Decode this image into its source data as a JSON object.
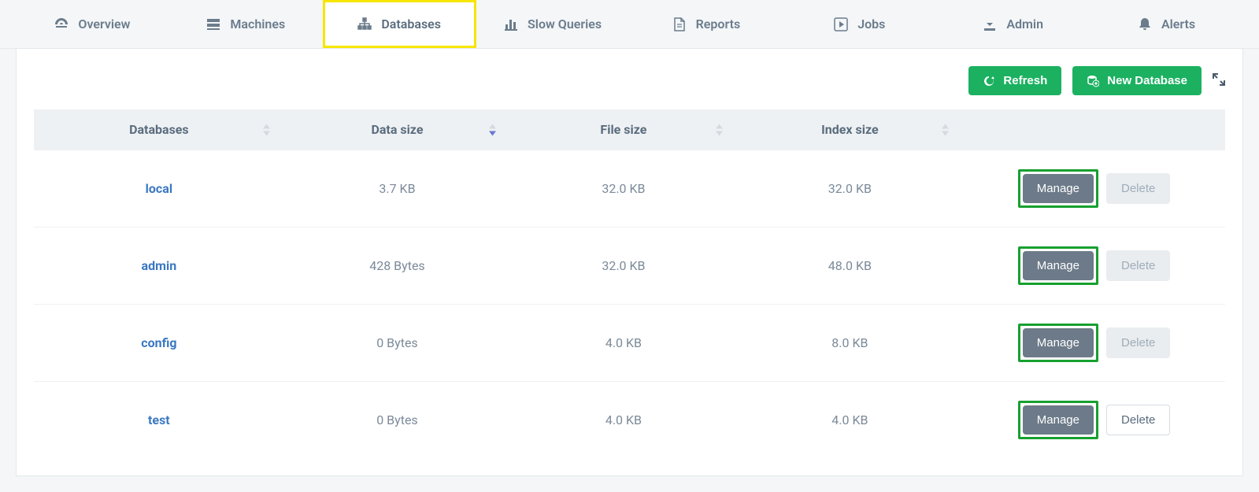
{
  "tabs": [
    {
      "label": "Overview",
      "icon": "dashboard"
    },
    {
      "label": "Machines",
      "icon": "server"
    },
    {
      "label": "Databases",
      "icon": "sitemap",
      "active": true
    },
    {
      "label": "Slow Queries",
      "icon": "bar-chart"
    },
    {
      "label": "Reports",
      "icon": "file"
    },
    {
      "label": "Jobs",
      "icon": "play"
    },
    {
      "label": "Admin",
      "icon": "download"
    },
    {
      "label": "Alerts",
      "icon": "bell"
    }
  ],
  "toolbar": {
    "refresh_label": "Refresh",
    "new_db_label": "New Database"
  },
  "table": {
    "headers": {
      "databases": "Databases",
      "data_size": "Data size",
      "file_size": "File size",
      "index_size": "Index size"
    },
    "rows": [
      {
        "name": "local",
        "data_size": "3.7 KB",
        "file_size": "32.0 KB",
        "index_size": "32.0 KB",
        "manage": "Manage",
        "delete": "Delete",
        "delete_enabled": false
      },
      {
        "name": "admin",
        "data_size": "428 Bytes",
        "file_size": "32.0 KB",
        "index_size": "48.0 KB",
        "manage": "Manage",
        "delete": "Delete",
        "delete_enabled": false
      },
      {
        "name": "config",
        "data_size": "0 Bytes",
        "file_size": "4.0 KB",
        "index_size": "8.0 KB",
        "manage": "Manage",
        "delete": "Delete",
        "delete_enabled": false
      },
      {
        "name": "test",
        "data_size": "0 Bytes",
        "file_size": "4.0 KB",
        "index_size": "4.0 KB",
        "manage": "Manage",
        "delete": "Delete",
        "delete_enabled": true
      }
    ]
  }
}
